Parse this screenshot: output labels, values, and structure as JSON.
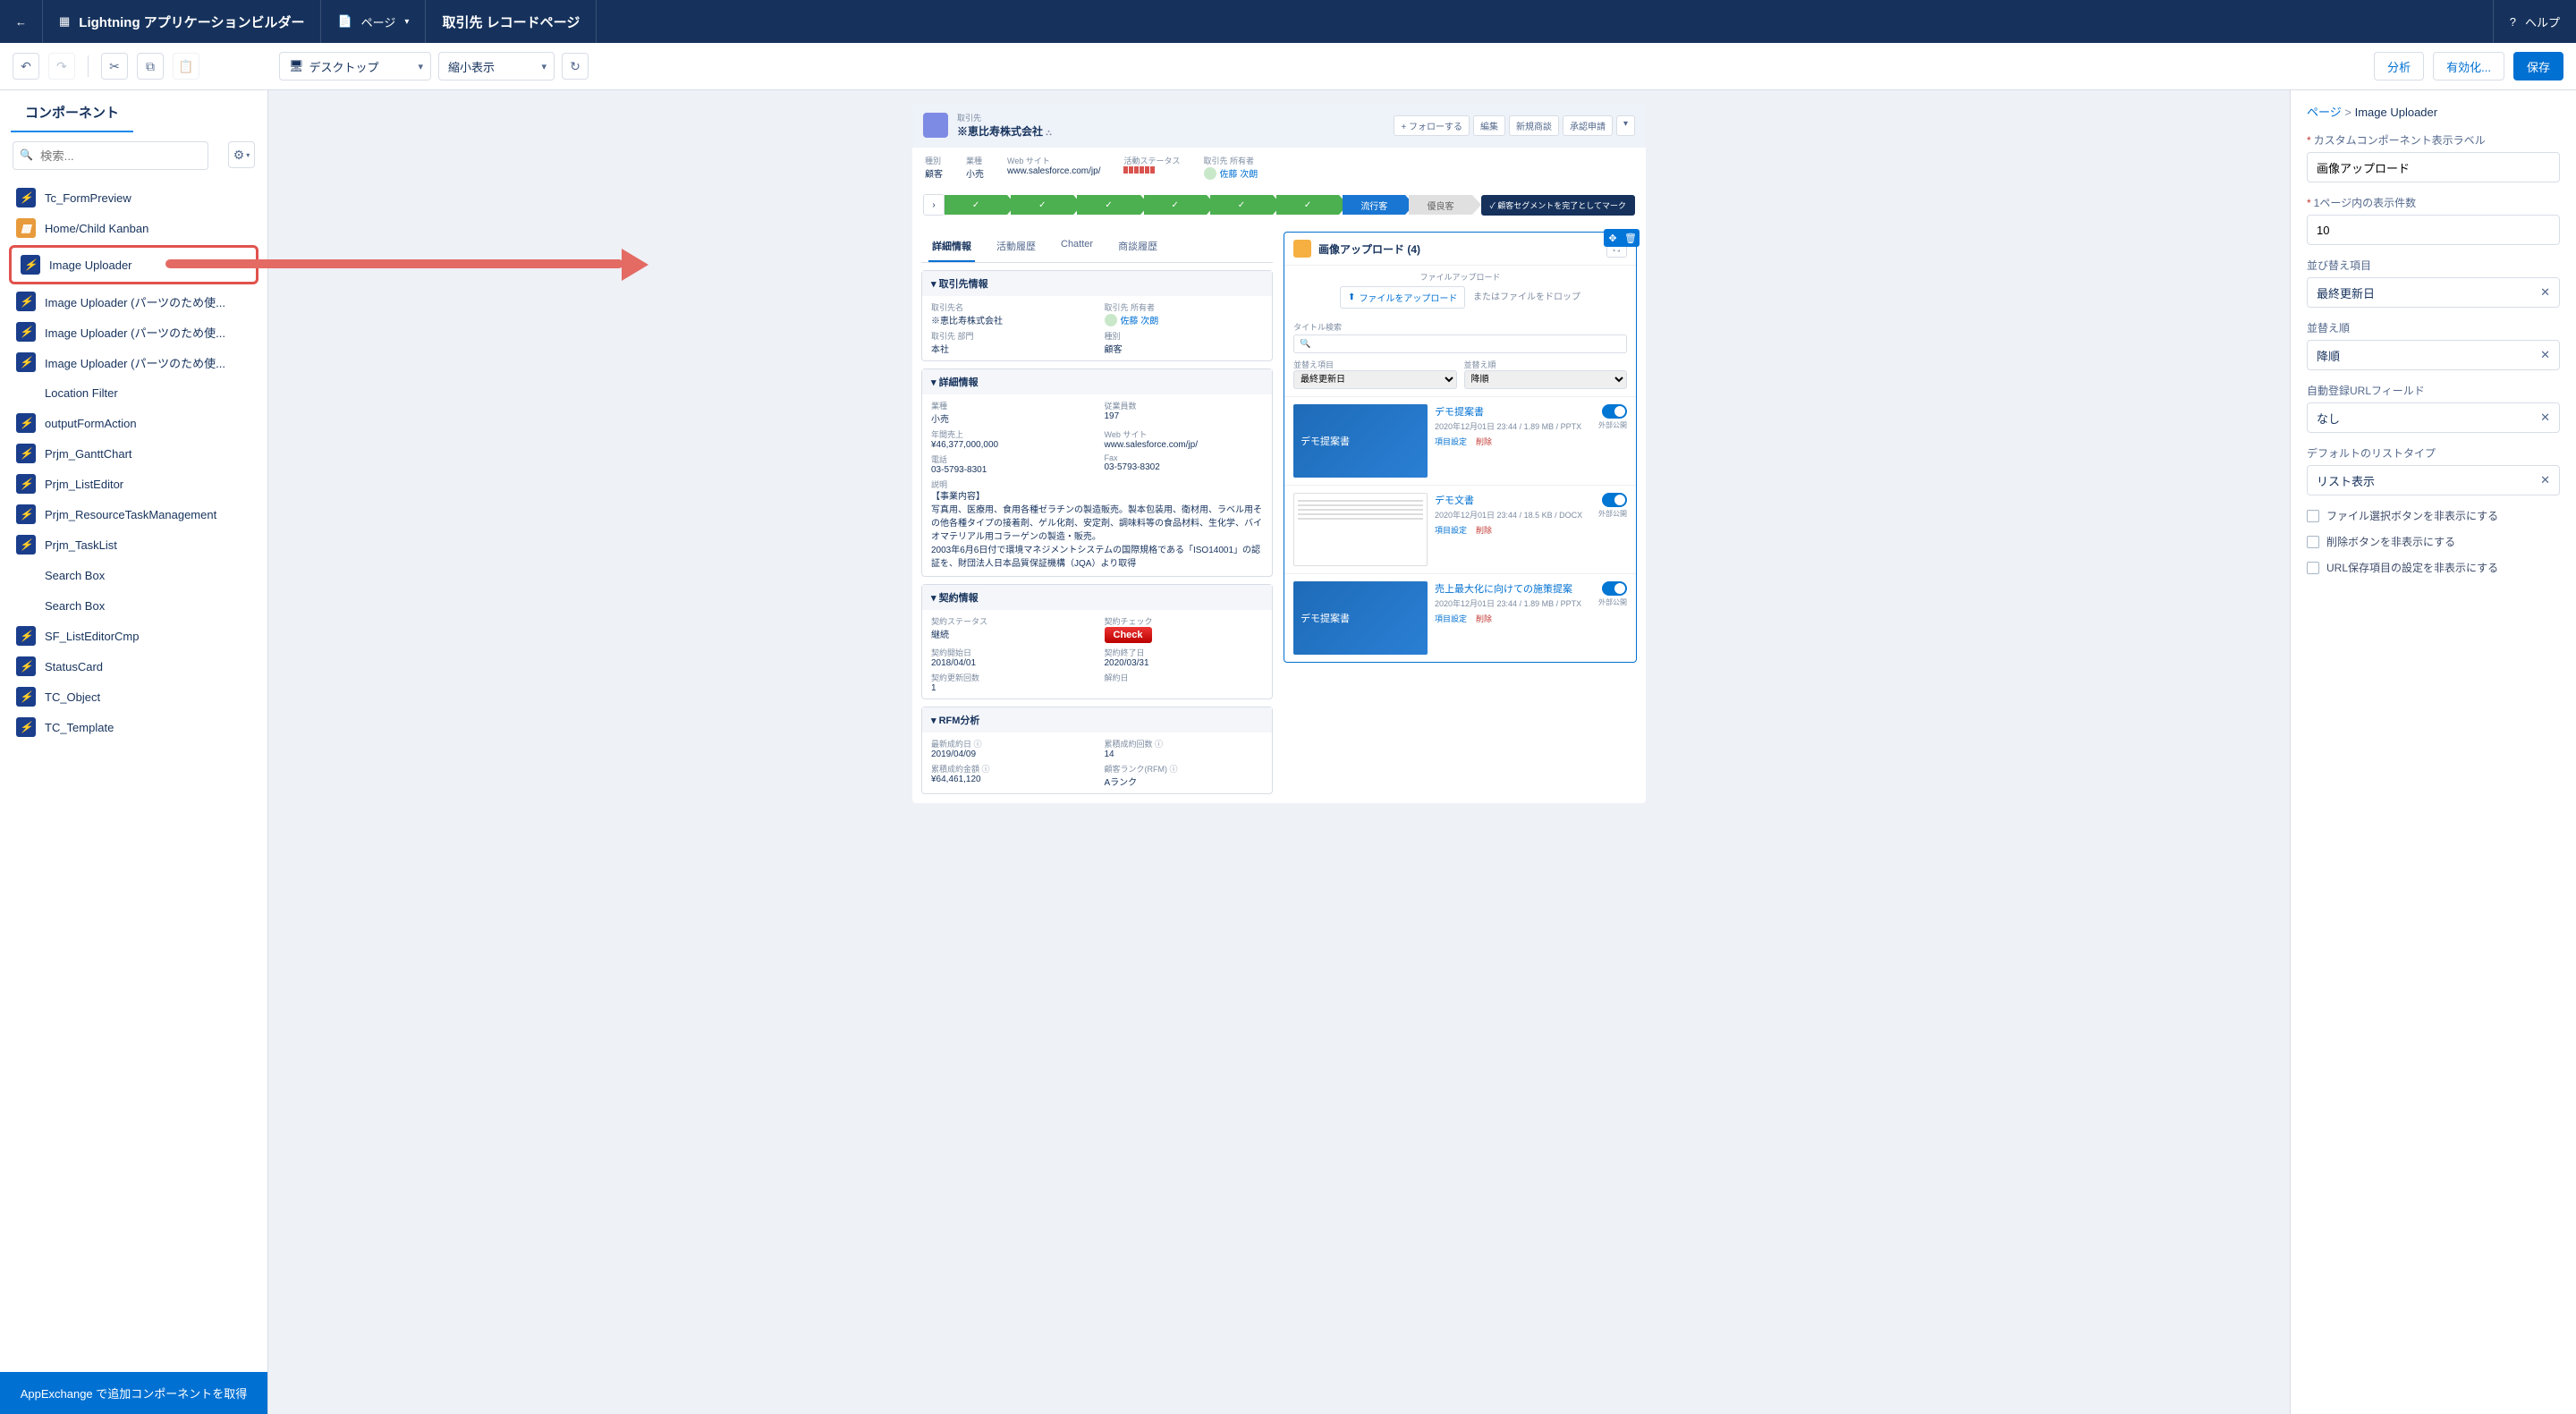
{
  "topbar": {
    "app_title": "Lightning アプリケーションビルダー",
    "page_menu": "ページ",
    "page_name": "取引先 レコードページ",
    "help": "ヘルプ"
  },
  "toolbar": {
    "device": "デスクトップ",
    "zoom": "縮小表示",
    "analyze": "分析",
    "activate": "有効化...",
    "save": "保存"
  },
  "left": {
    "heading": "コンポーネント",
    "search_placeholder": "検索...",
    "items": [
      {
        "label": "Tc_FormPreview"
      },
      {
        "label": "Home/Child Kanban"
      },
      {
        "label": "Image Uploader"
      },
      {
        "label": "Image Uploader (パーツのため使..."
      },
      {
        "label": "Image Uploader (パーツのため使..."
      },
      {
        "label": "Image Uploader (パーツのため使..."
      },
      {
        "label": "Location Filter"
      },
      {
        "label": "outputFormAction"
      },
      {
        "label": "Prjm_GanttChart"
      },
      {
        "label": "Prjm_ListEditor"
      },
      {
        "label": "Prjm_ResourceTaskManagement"
      },
      {
        "label": "Prjm_TaskList"
      },
      {
        "label": "Search Box"
      },
      {
        "label": "Search Box"
      },
      {
        "label": "SF_ListEditorCmp"
      },
      {
        "label": "StatusCard"
      },
      {
        "label": "TC_Object"
      },
      {
        "label": "TC_Template"
      }
    ],
    "appexchange": "AppExchange で追加コンポーネントを取得"
  },
  "record": {
    "obj": "取引先",
    "name": "※恵比寿株式会社",
    "actions": {
      "follow": "フォローする",
      "edit": "編集",
      "newopp": "新規商談",
      "submit": "承認申請"
    },
    "fields": {
      "type_l": "種別",
      "type_v": "顧客",
      "ind_l": "業種",
      "ind_v": "小売",
      "web_l": "Web サイト",
      "web_v": "www.salesforce.com/jp/",
      "stat_l": "活動ステータス",
      "owner_l": "取引先 所有者",
      "owner_v": "佐藤 次朗"
    },
    "path": {
      "a": "流行客",
      "b": "優良客",
      "btn": "顧客セグメントを完了としてマーク"
    },
    "tabs": {
      "t0": "詳細情報",
      "t1": "活動履歴",
      "t2": "Chatter",
      "t3": "商談履歴"
    }
  },
  "detail": {
    "s0": "取引先情報",
    "accname_l": "取引先名",
    "accname_v": "※恵比寿株式会社",
    "owner_l": "取引先 所有者",
    "owner_v": "佐藤 次朗",
    "dept_l": "取引先 部門",
    "dept_v": "本社",
    "type_l": "種別",
    "type_v": "顧客",
    "s1": "詳細情報",
    "ind_l": "業種",
    "ind_v": "小売",
    "emp_l": "従業員数",
    "emp_v": "197",
    "rev_l": "年間売上",
    "rev_v": "¥46,377,000,000",
    "web_l": "Web サイト",
    "web_v": "www.salesforce.com/jp/",
    "tel_l": "電話",
    "tel_v": "03-5793-8301",
    "fax_l": "Fax",
    "fax_v": "03-5793-8302",
    "desc_l": "説明",
    "desc_v": "【事業内容】\n写真用、医療用、食用各種ゼラチンの製造販売。製本包装用、衛材用、ラベル用その他各種タイプの接着剤、ゲル化剤、安定剤、調味料等の食品材料、生化学、バイオマテリアル用コラーゲンの製造・販売。\n2003年6月6日付で環境マネジメントシステムの国際規格である「ISO14001」の認証を、財団法人日本品質保証機構（JQA）より取得",
    "s2": "契約情報",
    "cst_l": "契約ステータス",
    "cst_v": "継続",
    "chk_l": "契約チェック",
    "start_l": "契約開始日",
    "start_v": "2018/04/01",
    "end_l": "契約終了日",
    "end_v": "2020/03/31",
    "cnt_l": "契約更新回数",
    "cnt_v": "1",
    "rel_l": "解約日",
    "s3": "RFM分析",
    "r1_l": "最新成約日",
    "r1_v": "2019/04/09",
    "r2_l": "累積成約金額",
    "r2_v": "¥64,461,120",
    "r3_l": "累積成約回数",
    "r3_v": "14",
    "r4_l": "顧客ランク(RFM)",
    "r4_v": "Aランク"
  },
  "uploader": {
    "title": "画像アップロード (4)",
    "up_lbl": "ファイルアップロード",
    "up_btn": "ファイルをアップロード",
    "up_drop": "またはファイルをドロップ",
    "search_l": "タイトル検索",
    "sort_l": "並替え項目",
    "sort_v": "最終更新日",
    "order_l": "並替え順",
    "order_v": "降順",
    "files": [
      {
        "title": "デモ提案書",
        "thumb": "デモ提案書",
        "meta": "2020年12月01日 23:44 / 1.89 MB / PPTX",
        "a": "項目設定",
        "b": "削除",
        "ext": "外部公開"
      },
      {
        "title": "デモ文書",
        "doc": true,
        "meta": "2020年12月01日 23:44 / 18.5 KB / DOCX",
        "a": "項目設定",
        "b": "削除",
        "ext": "外部公開"
      },
      {
        "title": "売上最大化に向けての施策提案",
        "thumb": "デモ提案書",
        "meta": "2020年12月01日 23:44 / 1.89 MB / PPTX",
        "a": "項目設定",
        "b": "削除",
        "ext": "外部公開"
      }
    ]
  },
  "props": {
    "bc_page": "ページ",
    "bc_comp": "Image Uploader",
    "label_l": "カスタムコンポーネント表示ラベル",
    "label_v": "画像アップロード",
    "perpage_l": "1ページ内の表示件数",
    "perpage_v": "10",
    "sort_l": "並び替え項目",
    "sort_v": "最終更新日",
    "order_l": "並替え順",
    "order_v": "降順",
    "urlf_l": "自動登録URLフィールド",
    "urlf_v": "なし",
    "list_l": "デフォルトのリストタイプ",
    "list_v": "リスト表示",
    "cb1": "ファイル選択ボタンを非表示にする",
    "cb2": "削除ボタンを非表示にする",
    "cb3": "URL保存項目の設定を非表示にする"
  }
}
